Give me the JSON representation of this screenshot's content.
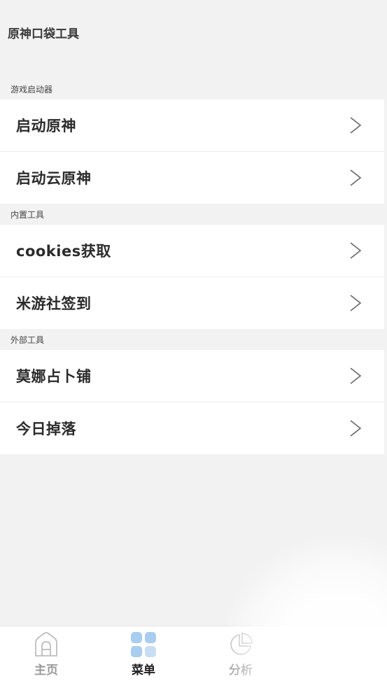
{
  "app": {
    "title": "原神口袋工具"
  },
  "sections": [
    {
      "header": "游戏启动器",
      "items": [
        {
          "label": "启动原神"
        },
        {
          "label": "启动云原神"
        }
      ]
    },
    {
      "header": "内置工具",
      "items": [
        {
          "label": "cookies获取"
        },
        {
          "label": "米游社签到"
        }
      ]
    },
    {
      "header": "外部工具",
      "items": [
        {
          "label": "莫娜占卜铺"
        },
        {
          "label": "今日掉落"
        }
      ]
    }
  ],
  "tabbar": {
    "tabs": [
      {
        "label": "主页",
        "icon": "home-icon",
        "active": false
      },
      {
        "label": "菜单",
        "icon": "menu-grid-icon",
        "active": true
      },
      {
        "label": "分析",
        "icon": "pie-chart-icon",
        "active": false
      }
    ]
  },
  "colors": {
    "background": "#f2f2f2",
    "card": "#ffffff",
    "accent": "#a9cdef",
    "inactive": "#9a9a9a"
  }
}
